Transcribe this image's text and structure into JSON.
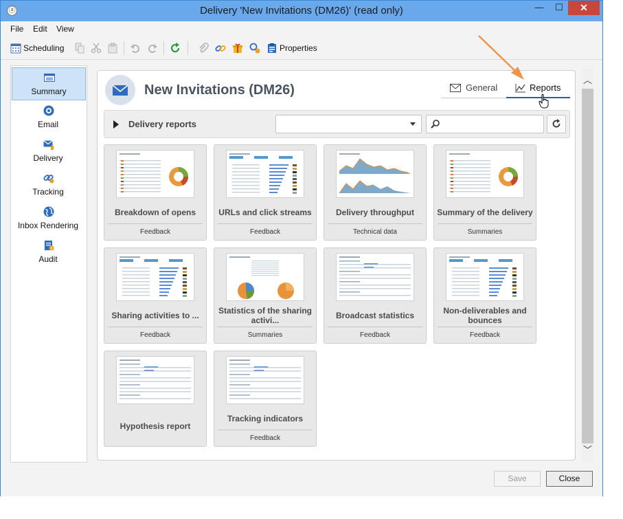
{
  "window": {
    "title": "Delivery 'New Invitations (DM26)' (read only)",
    "controls": {
      "minimize": "—",
      "maximize": "☐",
      "close": "✕"
    }
  },
  "menu": [
    "File",
    "Edit",
    "View"
  ],
  "toolbar": {
    "scheduling_label": "Scheduling",
    "properties_label": "Properties"
  },
  "sidebar": {
    "items": [
      {
        "label": "Summary",
        "icon": "summary-icon",
        "active": true
      },
      {
        "label": "Email",
        "icon": "email-icon",
        "active": false
      },
      {
        "label": "Delivery",
        "icon": "delivery-icon",
        "active": false
      },
      {
        "label": "Tracking",
        "icon": "tracking-icon",
        "active": false
      },
      {
        "label": "Inbox Rendering",
        "icon": "globe-icon",
        "active": false
      },
      {
        "label": "Audit",
        "icon": "audit-icon",
        "active": false
      }
    ]
  },
  "header": {
    "title": "New Invitations (DM26)",
    "tabs": [
      {
        "label": "General",
        "icon": "envelope-icon",
        "active": false
      },
      {
        "label": "Reports",
        "icon": "chart-line-icon",
        "active": true
      }
    ]
  },
  "filter": {
    "title": "Delivery reports",
    "select_value": "",
    "search_value": ""
  },
  "reports": [
    {
      "title_lines": [
        "Breakdown of opens"
      ],
      "category": "Feedback",
      "thumb": "donut"
    },
    {
      "title_lines": [
        "URLs and click streams"
      ],
      "category": "Feedback",
      "thumb": "table-bars"
    },
    {
      "title_lines": [
        "Delivery throughput"
      ],
      "category": "Technical data",
      "thumb": "area"
    },
    {
      "title_lines": [
        "Summary of the delivery"
      ],
      "category": "Summaries",
      "thumb": "donut"
    },
    {
      "title_lines": [
        "Sharing activities to ..."
      ],
      "category": "Feedback",
      "thumb": "table-bars"
    },
    {
      "title_lines": [
        "Statistics of the sharing",
        "activi..."
      ],
      "category": "Summaries",
      "thumb": "pies"
    },
    {
      "title_lines": [
        "Broadcast statistics"
      ],
      "category": "Feedback",
      "thumb": "table"
    },
    {
      "title_lines": [
        "Non-deliverables and",
        "bounces"
      ],
      "category": "Feedback",
      "thumb": "table-bars"
    },
    {
      "title_lines": [
        "Hypothesis report"
      ],
      "category": "",
      "thumb": "table"
    },
    {
      "title_lines": [
        "Tracking indicators"
      ],
      "category": "Feedback",
      "thumb": "table"
    }
  ],
  "footer": {
    "save_label": "Save",
    "close_label": "Close"
  },
  "colors": {
    "titlebar": "#6aa8ec",
    "accent": "#2a5ea8",
    "callout_arrow": "#f0944a",
    "close_button": "#c9463d"
  }
}
